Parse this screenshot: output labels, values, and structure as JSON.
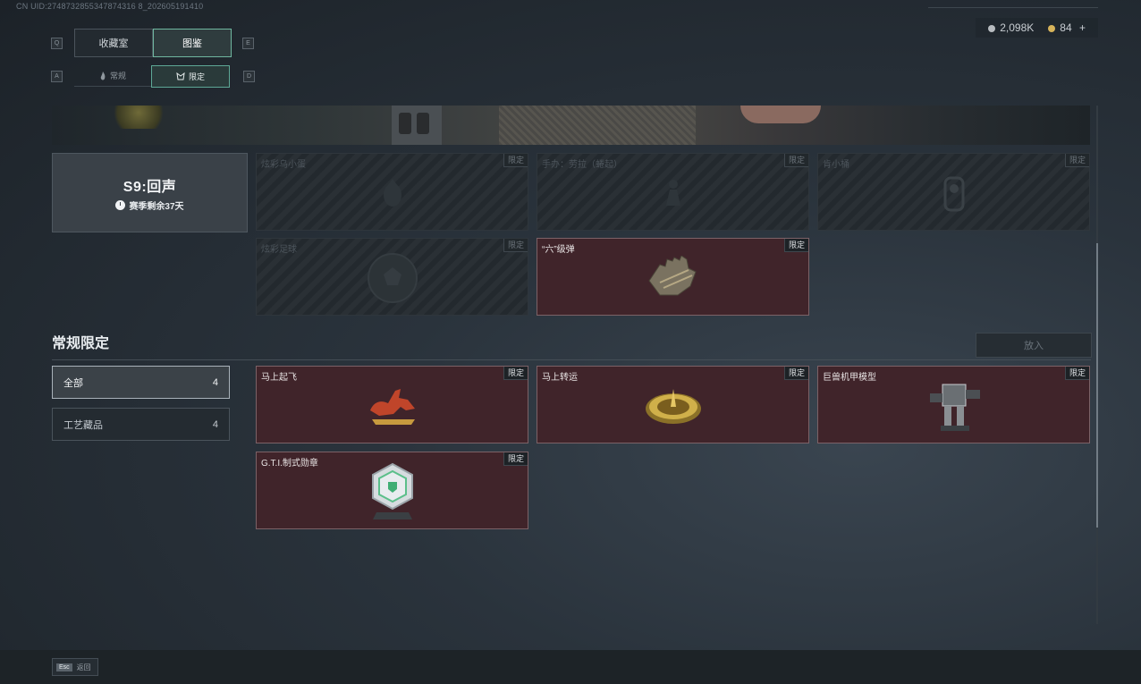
{
  "header": {
    "uid": "CN UID:2748732855347874316 8_202605191410",
    "currency": [
      {
        "icon": "silver-coin-icon",
        "value": "2,098K",
        "color": "#b8bcc0"
      },
      {
        "icon": "gold-coin-icon",
        "value": "84",
        "color": "#d6b35a"
      }
    ],
    "add_label": "+"
  },
  "keys": {
    "prev_tab": "Q",
    "next_tab": "E",
    "prev_sub": "A",
    "next_sub": "D"
  },
  "tabs": [
    {
      "label": "收藏室",
      "active": false
    },
    {
      "label": "图鉴",
      "active": true
    }
  ],
  "subtabs": [
    {
      "label": "常规",
      "icon": "flame-icon",
      "active": false
    },
    {
      "label": "限定",
      "icon": "limited-icon",
      "active": true
    }
  ],
  "season": {
    "title": "S9:回声",
    "remaining": "赛季剩余37天"
  },
  "season_items": [
    {
      "name": "炫彩乌小蛋",
      "badge": "限定",
      "owned": false,
      "icon": "crow-egg-icon"
    },
    {
      "name": "手办：劳拉（蜷起）",
      "badge": "限定",
      "owned": false,
      "icon": "figure-icon"
    },
    {
      "name": "肯小桶",
      "badge": "限定",
      "owned": false,
      "icon": "bucket-icon"
    },
    {
      "name": "炫彩足球",
      "badge": "限定",
      "owned": false,
      "icon": "football-icon"
    },
    {
      "name": "“六”级弹",
      "badge": "限定",
      "owned": true,
      "icon": "bullet-hand-icon"
    }
  ],
  "regular": {
    "title": "常规限定",
    "put_in": "放入",
    "filters": [
      {
        "label": "全部",
        "count": "4",
        "active": true
      },
      {
        "label": "工艺藏品",
        "count": "4",
        "active": false
      }
    ],
    "items": [
      {
        "name": "马上起飞",
        "badge": "限定",
        "owned": true,
        "icon": "flying-horse-icon"
      },
      {
        "name": "马上转运",
        "badge": "限定",
        "owned": true,
        "icon": "fortune-wheel-icon"
      },
      {
        "name": "巨兽机甲模型",
        "badge": "限定",
        "owned": true,
        "icon": "mech-model-icon"
      },
      {
        "name": "G.T.I.制式勋章",
        "badge": "限定",
        "owned": true,
        "icon": "gti-medal-icon"
      }
    ]
  },
  "footer": {
    "esc_key": "Esc",
    "back_label": "返回"
  }
}
